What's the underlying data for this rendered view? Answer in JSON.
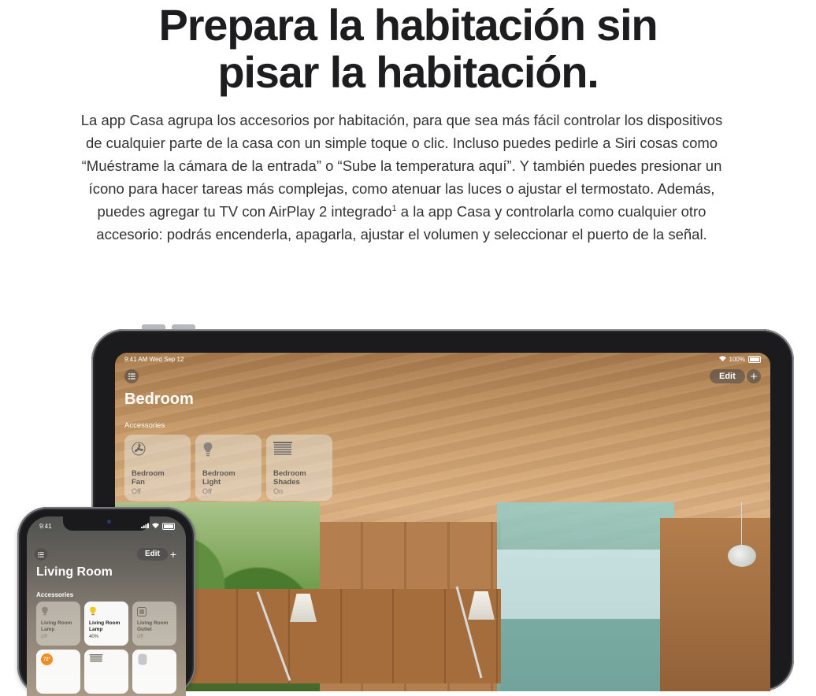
{
  "headline": {
    "line1": "Prepara la habitación sin",
    "line2": "pisar la habitación."
  },
  "intro": {
    "text_before_sup": "La app Casa agrupa los accesorios por habitación, para que sea más fácil controlar los dispositivos de cualquier parte de la casa con un simple toque o clic. Incluso puedes pedirle a Siri cosas como “Muéstrame la cámara de la entrada” o “Sube la temperatura aquí”. Y también puedes presionar un ícono para hacer tareas más complejas, como atenuar las luces o ajustar el termostato. Además, puedes agregar tu TV con AirPlay 2 integrado",
    "footnote": "1",
    "text_after_sup": " a la app Casa y controlarla como cualquier otro accesorio: podrás encenderla, apagarla, ajustar el volumen y seleccionar el puerto de la señal."
  },
  "ipad": {
    "status_time": "9:41 AM  Wed Sep 12",
    "status_battery": "100%",
    "edit_label": "Edit",
    "add_label": "+",
    "room_title": "Bedroom",
    "section_label": "Accessories",
    "tiles": [
      {
        "name_line1": "Bedroom",
        "name_line2": "Fan",
        "status": "Off",
        "icon": "fan-icon"
      },
      {
        "name_line1": "Bedroom",
        "name_line2": "Light",
        "status": "Off",
        "icon": "lightbulb-icon"
      },
      {
        "name_line1": "Bedroom",
        "name_line2": "Shades",
        "status": "On",
        "icon": "window-shades-icon"
      }
    ]
  },
  "iphone": {
    "status_time": "9:41",
    "edit_label": "Edit",
    "add_label": "+",
    "room_title": "Living Room",
    "section_label": "Accessories",
    "tiles": [
      {
        "name_line1": "Living Room",
        "name_line2": "Lamp",
        "status": "Off",
        "on": false,
        "icon": "lightbulb-icon"
      },
      {
        "name_line1": "Living Room",
        "name_line2": "Lamp",
        "status": "40%",
        "on": true,
        "icon": "lightbulb-on-icon"
      },
      {
        "name_line1": "Living Room",
        "name_line2": "Outlet",
        "status": "Off",
        "on": false,
        "icon": "outlet-icon"
      }
    ],
    "thermostat_value": "72°"
  },
  "colors": {
    "headline": "#1d1d1f",
    "body_text": "#333336",
    "bulb_on": "#f5c518",
    "thermostat": "#f58a1f"
  }
}
